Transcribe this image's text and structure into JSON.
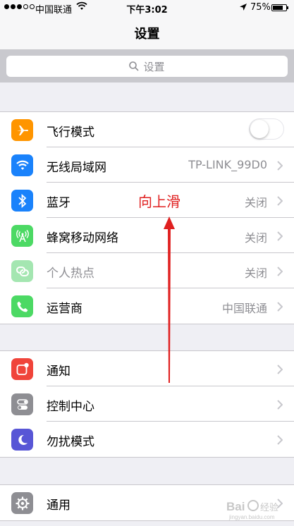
{
  "status_bar": {
    "carrier": "中国联通",
    "time": "下午3:02",
    "battery_percent": "75%",
    "battery_level": 0.75,
    "signal_bars_filled": 3,
    "signal_bars_total": 5
  },
  "nav": {
    "title": "设置"
  },
  "search": {
    "placeholder": "设置"
  },
  "groups": [
    {
      "rows": [
        {
          "icon": "airplane-icon",
          "icon_color": "#ff9500",
          "label": "飞行模式",
          "control": "toggle",
          "toggle_on": false
        },
        {
          "icon": "wifi-icon",
          "icon_color": "#1a82fb",
          "label": "无线局域网",
          "value": "TP-LINK_99D0"
        },
        {
          "icon": "bluetooth-icon",
          "icon_color": "#1a82fb",
          "label": "蓝牙",
          "value": "关闭"
        },
        {
          "icon": "cellular-icon",
          "icon_color": "#4cd964",
          "label": "蜂窝移动网络",
          "value": "关闭"
        },
        {
          "icon": "hotspot-icon",
          "icon_color": "#a4e6b1",
          "label": "个人热点",
          "value": "关闭",
          "dimmed": true
        },
        {
          "icon": "phone-icon",
          "icon_color": "#4cd964",
          "label": "运营商",
          "value": "中国联通"
        }
      ]
    },
    {
      "rows": [
        {
          "icon": "notifications-icon",
          "icon_color": "#f0443a",
          "label": "通知"
        },
        {
          "icon": "control-center-icon",
          "icon_color": "#8e8e93",
          "label": "控制中心"
        },
        {
          "icon": "moon-icon",
          "icon_color": "#5856d6",
          "label": "勿扰模式"
        }
      ]
    },
    {
      "rows": [
        {
          "icon": "gear-icon",
          "icon_color": "#8e8e93",
          "label": "通用"
        }
      ]
    }
  ],
  "annotation": {
    "text": "向上滑",
    "color": "#e02020"
  },
  "watermark": {
    "text": "Bai 经验",
    "sub": "jingyan.baidu.com"
  }
}
